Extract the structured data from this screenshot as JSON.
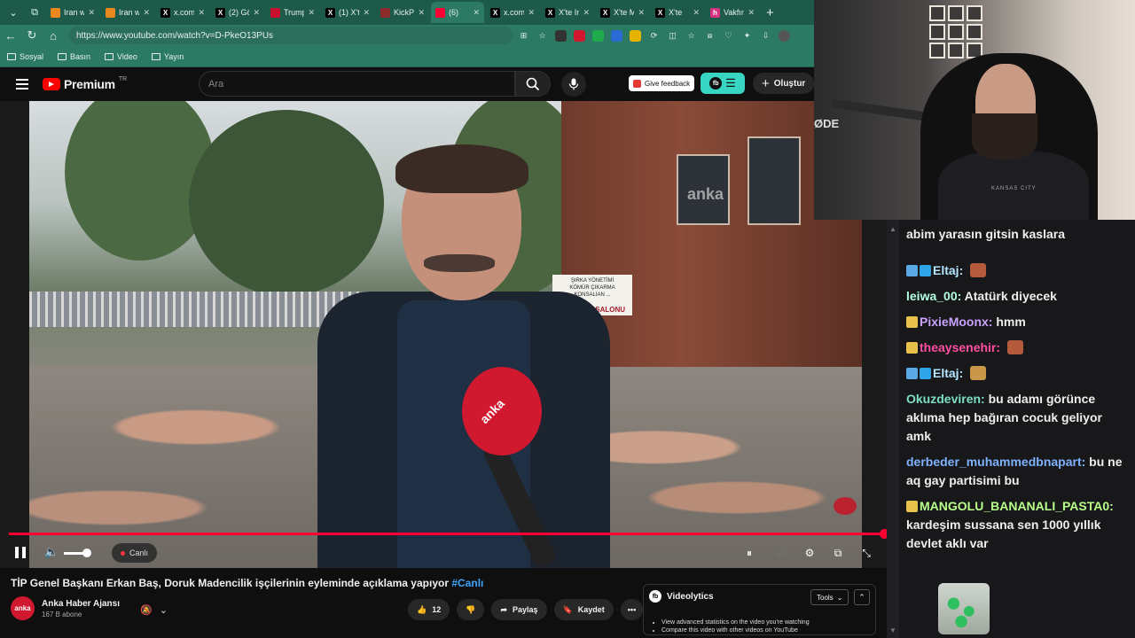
{
  "browser": {
    "tabs": [
      {
        "label": "Iran w",
        "fav": "#e8881f",
        "glyph": ""
      },
      {
        "label": "Iran w",
        "fav": "#e8881f",
        "glyph": ""
      },
      {
        "label": "x.com/",
        "fav": "#000000",
        "glyph": "X"
      },
      {
        "label": "(2) Gö",
        "fav": "#000000",
        "glyph": "X"
      },
      {
        "label": "Trump",
        "fav": "#c8102e",
        "glyph": ""
      },
      {
        "label": "(1) X'te",
        "fav": "#000000",
        "glyph": "X"
      },
      {
        "label": "KickPe",
        "fav": "#8b2b2b",
        "glyph": ""
      },
      {
        "label": "(6)",
        "fav": "#ff0033",
        "glyph": ""
      },
      {
        "label": "x.com/",
        "fav": "#000000",
        "glyph": "X"
      },
      {
        "label": "X'te In",
        "fav": "#000000",
        "glyph": "X"
      },
      {
        "label": "X'te M",
        "fav": "#000000",
        "glyph": "X"
      },
      {
        "label": "X'te",
        "fav": "#000000",
        "glyph": "X"
      },
      {
        "label": "Vakfın",
        "fav": "#d63384",
        "glyph": "h"
      }
    ],
    "active_tab": 7,
    "url": "https://www.youtube.com/watch?v=D-PkeO13PUs",
    "bookmarks": [
      "Sosyal",
      "Basın",
      "Video",
      "Yayın"
    ]
  },
  "youtube": {
    "logo": "Premium",
    "logo_region": "TR",
    "search_placeholder": "Ara",
    "feedback_label": "Give feedback",
    "create_label": "Oluştur"
  },
  "video": {
    "live_label": "Canlı",
    "watermark": "anka",
    "sign_top": "ŞIRKA YÖNETİMİ\nKÖMÜR ÇIKARMA\nKONSALIAN ...",
    "sign_bottom": "KOKTEYL SALONU",
    "mic_brand": "anka",
    "volume_level": 0.85
  },
  "below": {
    "title": "TİP Genel Başkanı Erkan Baş, Doruk Madencilik işçilerinin eyleminde açıklama yapıyor",
    "hashtag": "#Canlı",
    "channel_name": "Anka Haber Ajansı",
    "channel_subs": "167 B abone",
    "likes": "12",
    "share_label": "Paylaş",
    "save_label": "Kaydet"
  },
  "videolytics": {
    "name": "Videolytics",
    "tools_label": "Tools",
    "items": [
      "View advanced statistics on the video you're watching",
      "Compare this video with other videos on YouTube"
    ]
  },
  "webcam": {
    "overlay_text": "ØDE",
    "shirt_text": "KANSAS CITY"
  },
  "chat": {
    "messages": [
      {
        "user": "",
        "color": "#eeeeee",
        "text": "abim yarasın gitsin kaslara",
        "badges": [],
        "emote": ""
      },
      {
        "user": "Eltaj:",
        "color": "#b3e5ff",
        "text": "",
        "badges": [
          "#5aa9e6",
          "#2fa4e7"
        ],
        "emote": "#b55a3c"
      },
      {
        "user": "leiwa_00:",
        "color": "#b3ffe0",
        "text": "Atatürk diyecek",
        "badges": [],
        "emote": ""
      },
      {
        "user": "PixieMoonx:",
        "color": "#c9a2ff",
        "text": "hmm",
        "badges": [
          "#e8c14a"
        ],
        "emote": ""
      },
      {
        "user": "theaysenehir:",
        "color": "#ff4fa3",
        "text": "",
        "badges": [
          "#e8c14a"
        ],
        "emote": "#b55a3c"
      },
      {
        "user": "Eltaj:",
        "color": "#b3e5ff",
        "text": "",
        "badges": [
          "#5aa9e6",
          "#2fa4e7"
        ],
        "emote": "#c9964a"
      },
      {
        "user": "Okuzdeviren:",
        "color": "#7ce0c0",
        "text": "bu adamı görünce aklıma hep bağıran cocuk geliyor amk",
        "badges": [],
        "emote": ""
      },
      {
        "user": "derbeder_muhammedbnapart:",
        "color": "#7fb2ff",
        "text": "bu ne aq gay partisimi bu",
        "badges": [],
        "emote": ""
      },
      {
        "user": "MANGOLU_BANANALI_PASTA0:",
        "color": "#b8ff8a",
        "text": "kardeşim sussana sen 1000 yıllık devlet aklı var",
        "badges": [
          "#e8c14a"
        ],
        "emote": ""
      }
    ]
  }
}
